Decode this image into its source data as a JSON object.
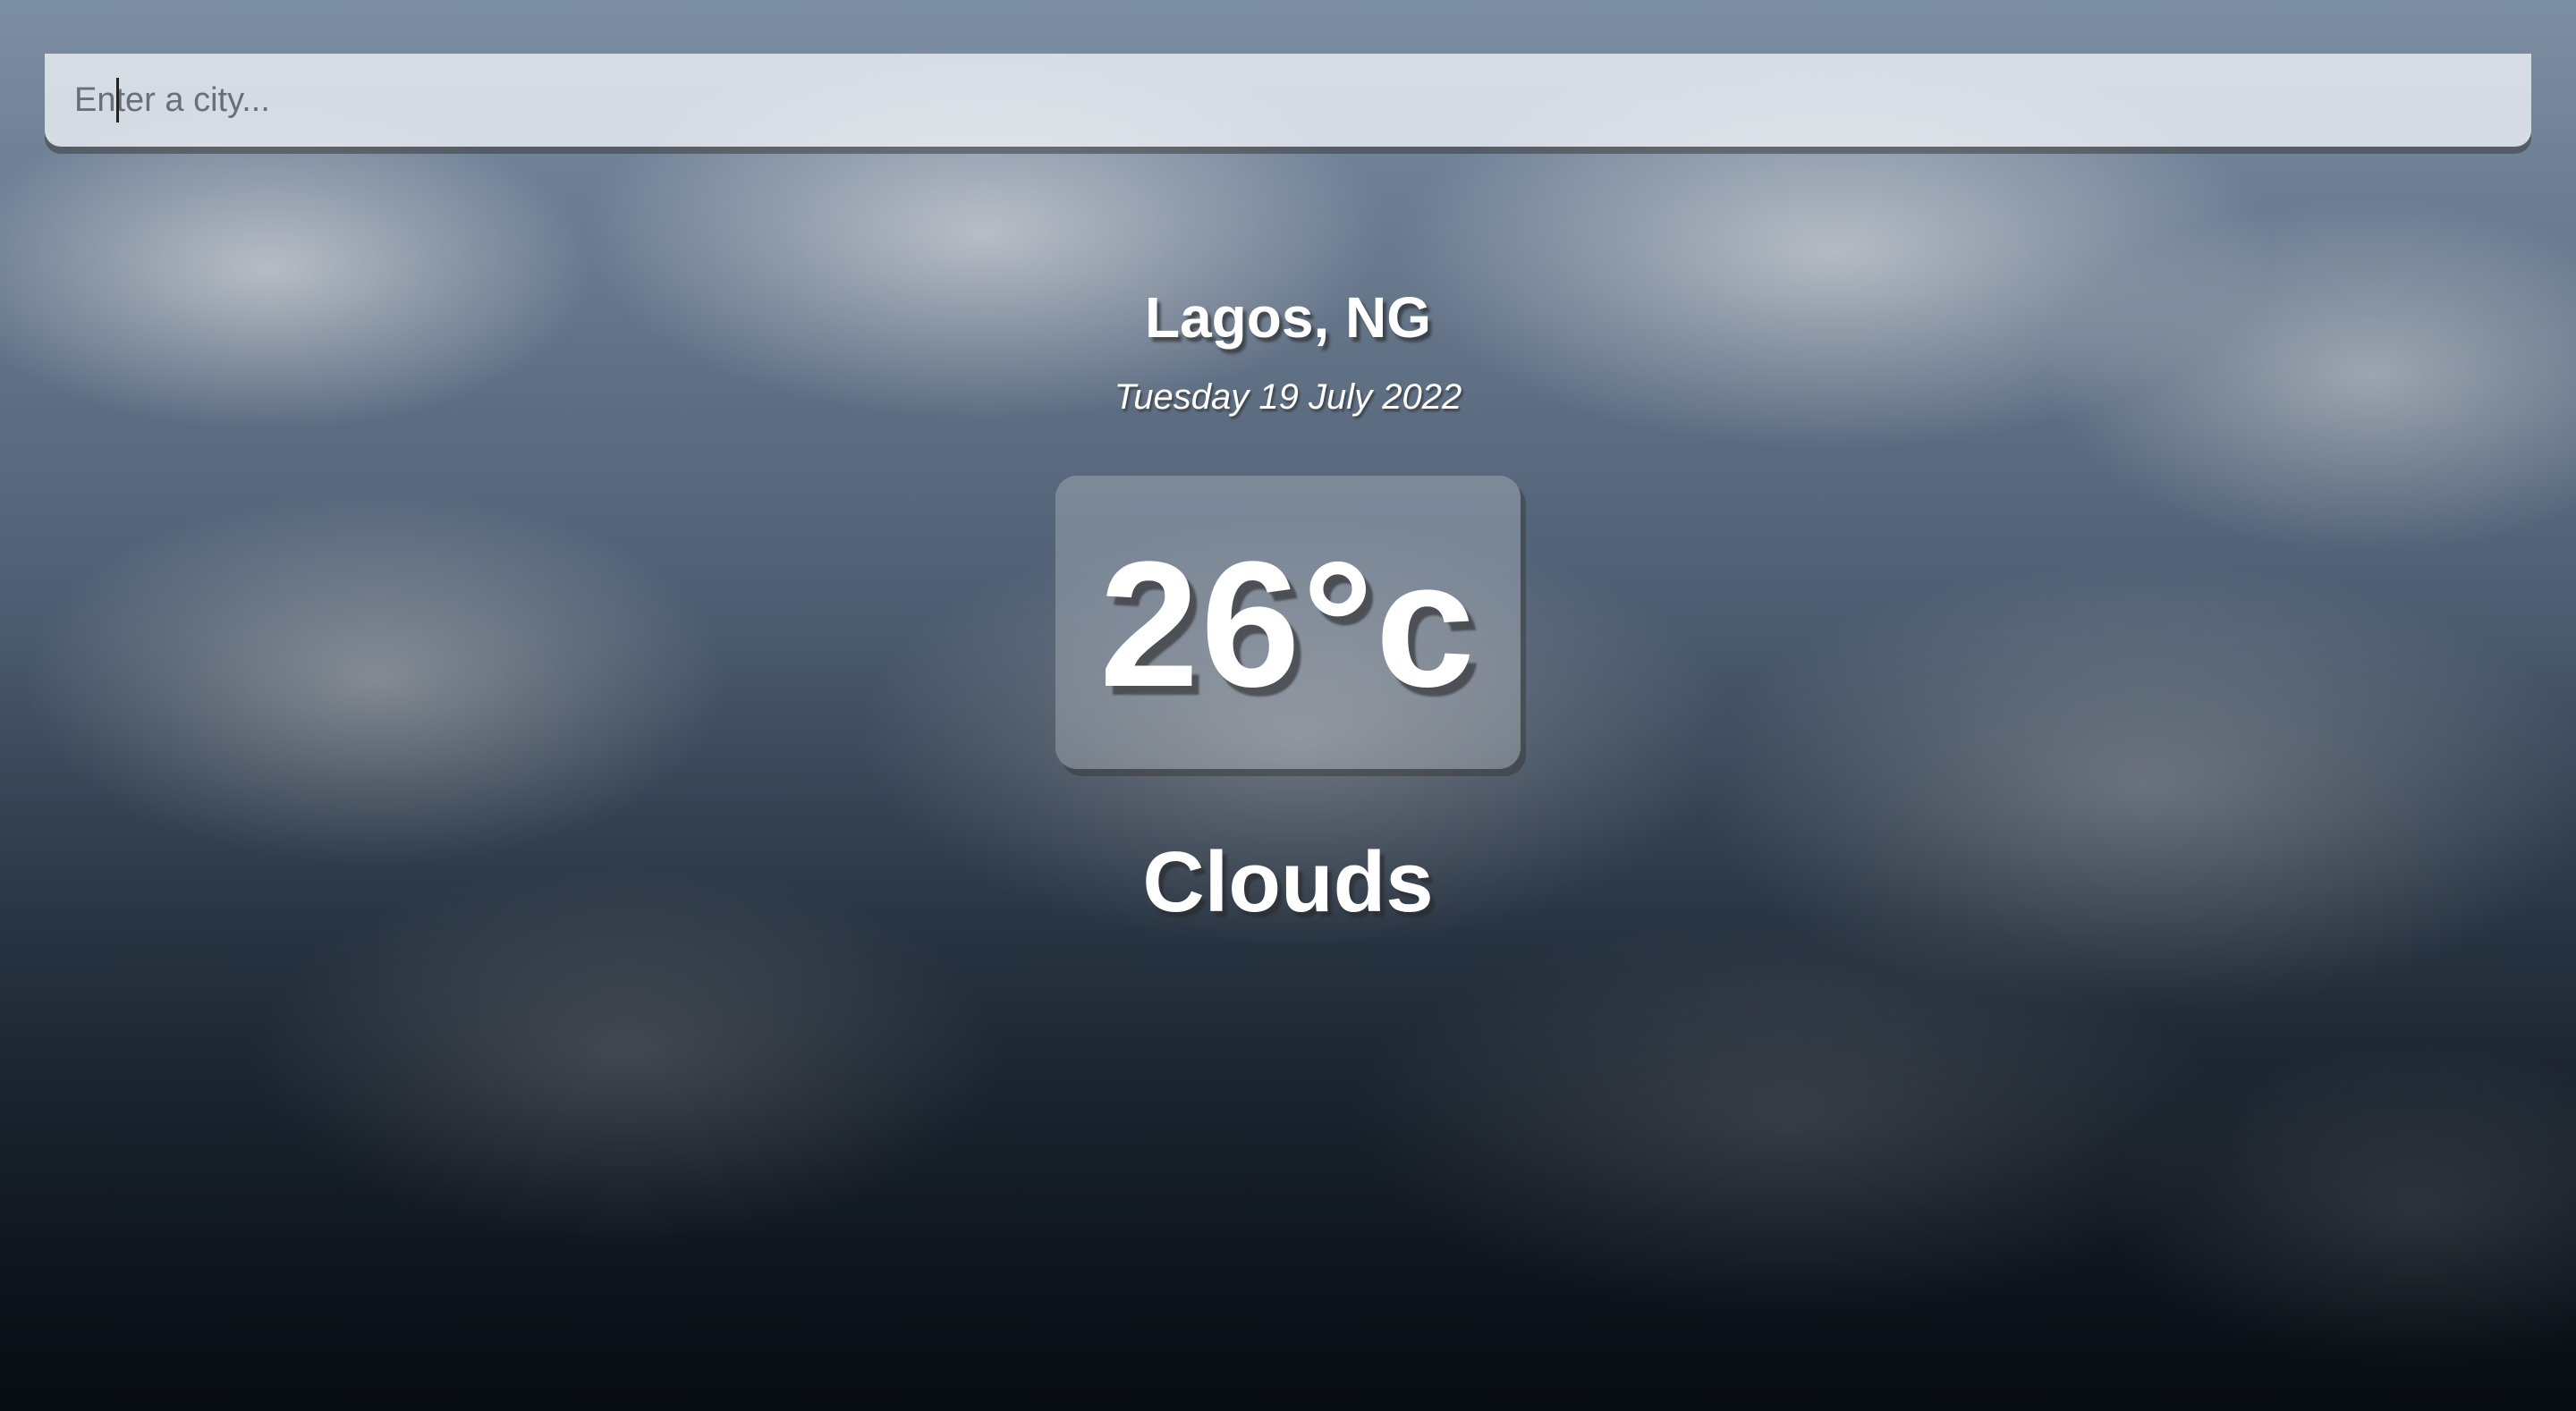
{
  "search": {
    "placeholder": "Enter a city...",
    "value": ""
  },
  "weather": {
    "location": "Lagos, NG",
    "date": "Tuesday 19 July 2022",
    "temperature": "26°c",
    "condition": "Clouds"
  },
  "colors": {
    "text": "#ffffff",
    "search_background": "#f0f3f7",
    "background_top": "#7d8ea3",
    "background_bottom": "#0f1a27"
  }
}
